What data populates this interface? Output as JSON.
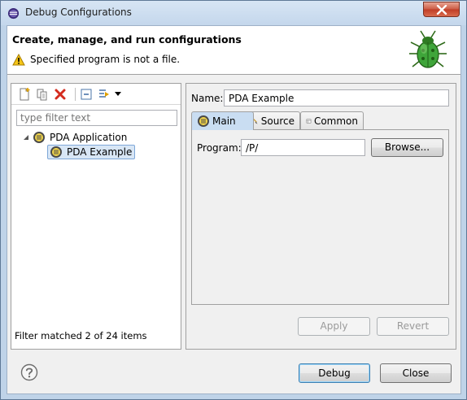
{
  "window": {
    "title": "Debug Configurations"
  },
  "banner": {
    "title": "Create, manage, and run configurations",
    "message": "Specified program is not a file."
  },
  "left": {
    "filter_placeholder": "type filter text",
    "tree": [
      {
        "label": "PDA Application",
        "expanded": true
      },
      {
        "label": "PDA Example",
        "selected": true
      }
    ],
    "status": "Filter matched 2 of 24 items"
  },
  "right": {
    "name_label": "Name:",
    "name_value": "PDA Example",
    "tabs": [
      {
        "label": "Main",
        "active": true
      },
      {
        "label": "Source"
      },
      {
        "label": "Common"
      }
    ],
    "program_label": "Program:",
    "program_value": "/P/",
    "browse_label": "Browse...",
    "apply_label": "Apply",
    "revert_label": "Revert"
  },
  "footer": {
    "debug_label": "Debug",
    "close_label": "Close"
  },
  "colors": {
    "accent": "#3c7fb1",
    "close_red": "#c03c25",
    "error_red": "#d42b1e"
  }
}
